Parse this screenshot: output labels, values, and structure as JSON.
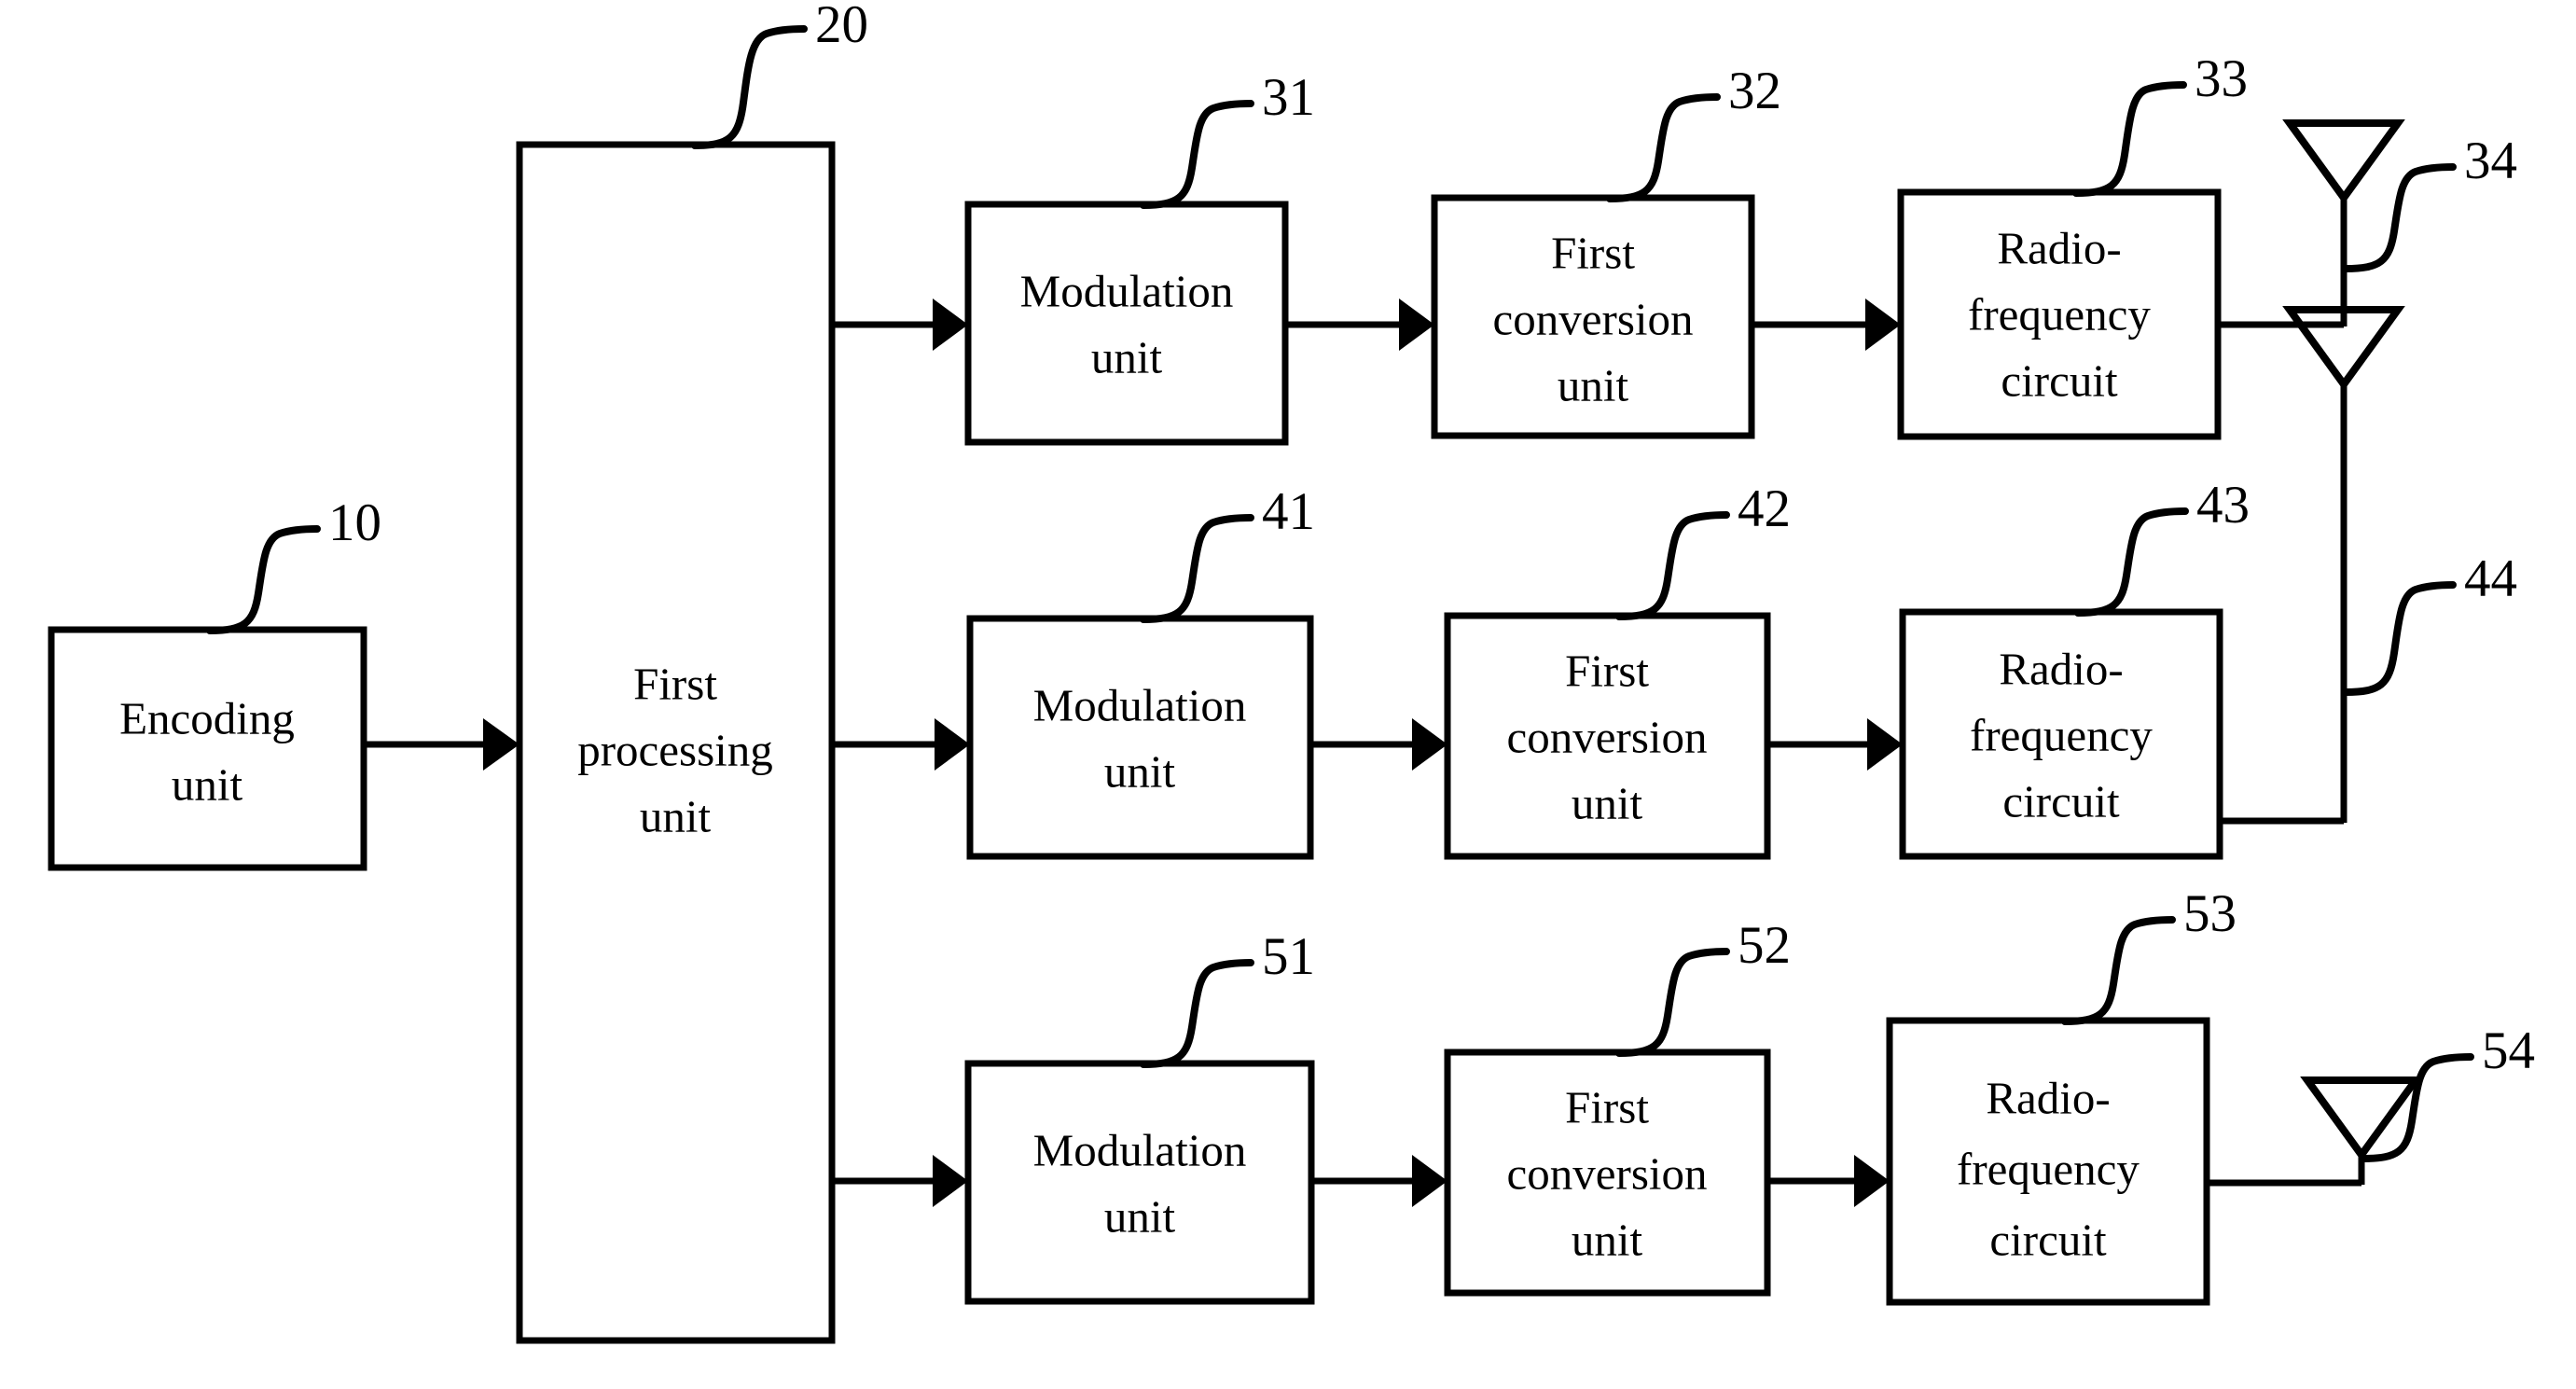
{
  "figure": {
    "type": "patent-block-diagram",
    "background_color": "#ffffff",
    "line_color": "#000000"
  },
  "blocks": {
    "encoding_unit": {
      "line1": "Encoding",
      "line2": "unit",
      "ref": "10"
    },
    "first_processing_unit": {
      "line1": "First",
      "line2": "processing",
      "line3": "unit",
      "ref": "20"
    },
    "chain1": {
      "modulation": {
        "line1": "Modulation",
        "line2": "unit",
        "ref": "31"
      },
      "conversion": {
        "line1": "First",
        "line2": "conversion",
        "line3": "unit",
        "ref": "32"
      },
      "radio": {
        "line1": "Radio-",
        "line2": "frequency",
        "line3": "circuit",
        "ref": "33"
      },
      "antenna": {
        "ref": "34"
      }
    },
    "chain2": {
      "modulation": {
        "line1": "Modulation",
        "line2": "unit",
        "ref": "41"
      },
      "conversion": {
        "line1": "First",
        "line2": "conversion",
        "line3": "unit",
        "ref": "42"
      },
      "radio": {
        "line1": "Radio-",
        "line2": "frequency",
        "line3": "circuit",
        "ref": "43"
      },
      "antenna": {
        "ref": "44"
      }
    },
    "chain3": {
      "modulation": {
        "line1": "Modulation",
        "line2": "unit",
        "ref": "51"
      },
      "conversion": {
        "line1": "First",
        "line2": "conversion",
        "line3": "unit",
        "ref": "52"
      },
      "radio": {
        "line1": "Radio-",
        "line2": "frequency",
        "line3": "circuit",
        "ref": "53"
      },
      "antenna": {
        "ref": "54"
      }
    }
  }
}
